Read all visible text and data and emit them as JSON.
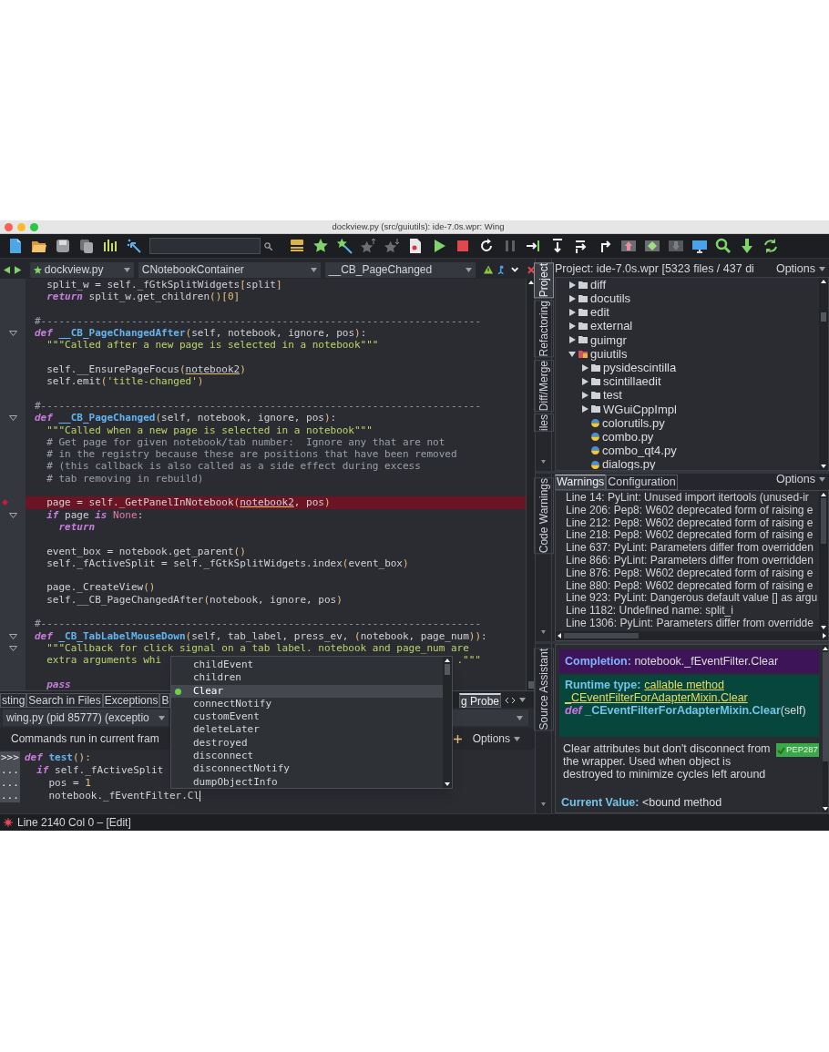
{
  "window": {
    "title": "dockview.py (src/guiutils): ide-7.0s.wpr: Wing"
  },
  "editor": {
    "file_menu": "dockview.py",
    "class_menu": "CNotebookContainer",
    "method_menu": "__CB_PageChanged",
    "lines": [
      {
        "fold": false,
        "error": false,
        "tokens": [
          {
            "kind": "p",
            "text": "  split_w = self._fGtkSplitWidgets"
          },
          {
            "kind": "pa",
            "text": "["
          },
          {
            "kind": "p",
            "text": "split"
          },
          {
            "kind": "pa",
            "text": "]"
          }
        ]
      },
      {
        "fold": false,
        "error": false,
        "tokens": [
          {
            "kind": "kw",
            "text": "  return"
          },
          {
            "kind": "p",
            "text": " split_w.get_children"
          },
          {
            "kind": "pa",
            "text": "()[0]"
          }
        ]
      },
      {
        "fold": false,
        "error": false
      },
      {
        "fold": false,
        "error": false,
        "tokens": [
          {
            "kind": "com",
            "text": "#-------------------------------------------------------------------------"
          }
        ]
      },
      {
        "fold": true,
        "error": false,
        "tokens": [
          {
            "kind": "kw",
            "text": "def"
          },
          {
            "kind": "fn",
            "text": " __CB_PageChangedAfter"
          },
          {
            "kind": "pa",
            "text": "("
          },
          {
            "kind": "p",
            "text": "self, notebook, ignore, pos"
          },
          {
            "kind": "pa",
            "text": ")"
          },
          {
            "kind": "p",
            "text": ":"
          }
        ]
      },
      {
        "fold": false,
        "error": false,
        "tokens": [
          {
            "kind": "str",
            "text": "  \"\"\"Called after a new page is selected in a notebook\"\"\""
          }
        ]
      },
      {
        "fold": false,
        "error": false
      },
      {
        "fold": false,
        "error": false,
        "tokens": [
          {
            "kind": "p",
            "text": "  self.__EnsurePageFocus"
          },
          {
            "kind": "pa",
            "text": "("
          },
          {
            "kind": "warn",
            "text": "notebook2"
          },
          {
            "kind": "pa",
            "text": ")"
          }
        ]
      },
      {
        "fold": false,
        "error": false,
        "tokens": [
          {
            "kind": "p",
            "text": "  self.emit"
          },
          {
            "kind": "pa",
            "text": "("
          },
          {
            "kind": "str",
            "text": "'title-changed'"
          },
          {
            "kind": "pa",
            "text": ")"
          }
        ]
      },
      {
        "fold": false,
        "error": false
      },
      {
        "fold": false,
        "error": false,
        "tokens": [
          {
            "kind": "com",
            "text": "#-------------------------------------------------------------------------"
          }
        ]
      },
      {
        "fold": true,
        "error": false,
        "tokens": [
          {
            "kind": "kw",
            "text": "def"
          },
          {
            "kind": "fn",
            "text": " __CB_PageChanged"
          },
          {
            "kind": "pa",
            "text": "("
          },
          {
            "kind": "p",
            "text": "self, notebook, ignore, pos"
          },
          {
            "kind": "pa",
            "text": ")"
          },
          {
            "kind": "p",
            "text": ":"
          }
        ]
      },
      {
        "fold": false,
        "error": false,
        "tokens": [
          {
            "kind": "str",
            "text": "  \"\"\"Called when a new page is selected in a notebook\"\"\""
          }
        ]
      },
      {
        "fold": false,
        "error": false,
        "tokens": [
          {
            "kind": "com",
            "text": "  # Get page for given notebook/tab number:  Ignore any that are not"
          }
        ]
      },
      {
        "fold": false,
        "error": false,
        "tokens": [
          {
            "kind": "com",
            "text": "  # in the registry because these are positions that have been removed"
          }
        ]
      },
      {
        "fold": false,
        "error": false,
        "tokens": [
          {
            "kind": "com",
            "text": "  # (this callback is also called as a side effect during excess"
          }
        ]
      },
      {
        "fold": false,
        "error": false,
        "tokens": [
          {
            "kind": "com",
            "text": "  # tab removing in rebuild)"
          }
        ]
      },
      {
        "fold": false,
        "error": false
      },
      {
        "fold": false,
        "error": true,
        "tokens": [
          {
            "kind": "p",
            "text": "  page = self._GetPanelInNotebook"
          },
          {
            "kind": "pa",
            "text": "("
          },
          {
            "kind": "warn",
            "text": "notebook2"
          },
          {
            "kind": "p",
            "text": ", pos"
          },
          {
            "kind": "pa",
            "text": ")"
          }
        ]
      },
      {
        "fold": true,
        "error": false,
        "tokens": [
          {
            "kind": "kw",
            "text": "  if"
          },
          {
            "kind": "p",
            "text": " page "
          },
          {
            "kind": "kw",
            "text": "is"
          },
          {
            "kind": "const",
            "text": " None"
          },
          {
            "kind": "p",
            "text": ":"
          }
        ]
      },
      {
        "fold": false,
        "error": false,
        "tokens": [
          {
            "kind": "kw",
            "text": "    return"
          }
        ]
      },
      {
        "fold": false,
        "error": false
      },
      {
        "fold": false,
        "error": false,
        "tokens": [
          {
            "kind": "p",
            "text": "  event_box = notebook.get_parent"
          },
          {
            "kind": "pa",
            "text": "()"
          }
        ]
      },
      {
        "fold": false,
        "error": false,
        "tokens": [
          {
            "kind": "p",
            "text": "  self._fActiveSplit = self._fGtkSplitWidgets.index"
          },
          {
            "kind": "pa",
            "text": "("
          },
          {
            "kind": "p",
            "text": "event_box"
          },
          {
            "kind": "pa",
            "text": ")"
          }
        ]
      },
      {
        "fold": false,
        "error": false
      },
      {
        "fold": false,
        "error": false,
        "tokens": [
          {
            "kind": "p",
            "text": "  page._CreateView"
          },
          {
            "kind": "pa",
            "text": "()"
          }
        ]
      },
      {
        "fold": false,
        "error": false,
        "tokens": [
          {
            "kind": "p",
            "text": "  self.__CB_PageChangedAfter"
          },
          {
            "kind": "pa",
            "text": "("
          },
          {
            "kind": "p",
            "text": "notebook, ignore, pos"
          },
          {
            "kind": "pa",
            "text": ")"
          }
        ]
      },
      {
        "fold": false,
        "error": false
      },
      {
        "fold": false,
        "error": false,
        "tokens": [
          {
            "kind": "com",
            "text": "#-------------------------------------------------------------------------"
          }
        ]
      },
      {
        "fold": true,
        "error": false,
        "tokens": [
          {
            "kind": "kw",
            "text": "def"
          },
          {
            "kind": "fn",
            "text": " _CB_TabLabelMouseDown"
          },
          {
            "kind": "pa",
            "text": "("
          },
          {
            "kind": "p",
            "text": "self, tab_label, press_ev, "
          },
          {
            "kind": "pa",
            "text": "("
          },
          {
            "kind": "p",
            "text": "notebook, page_num"
          },
          {
            "kind": "pa",
            "text": "))"
          },
          {
            "kind": "p",
            "text": ":"
          }
        ]
      },
      {
        "fold": true,
        "error": false,
        "tokens": [
          {
            "kind": "str",
            "text": "  \"\"\"Callback for click signal on a tab label. notebook and page_num are"
          }
        ]
      },
      {
        "fold": false,
        "error": false,
        "segments": [
          {
            "tokens": [
              {
                "kind": "str",
                "text": "  extra arguments whi"
              }
            ]
          },
          {
            "tokens": [
              {
                "kind": "str",
                "text": ".\"\"\""
              }
            ]
          }
        ]
      },
      {
        "fold": false,
        "error": false
      },
      {
        "fold": false,
        "error": false,
        "tokens": [
          {
            "kind": "kw",
            "text": "  pass"
          }
        ]
      }
    ]
  },
  "completion_popup": {
    "items": [
      {
        "text": "childEvent",
        "selected": false
      },
      {
        "text": "children",
        "selected": false
      },
      {
        "text": "Clear",
        "selected": true
      },
      {
        "text": "connectNotify",
        "selected": false
      },
      {
        "text": "customEvent",
        "selected": false
      },
      {
        "text": "deleteLater",
        "selected": false
      },
      {
        "text": "destroyed",
        "selected": false
      },
      {
        "text": "disconnect",
        "selected": false
      },
      {
        "text": "disconnectNotify",
        "selected": false
      },
      {
        "text": "dumpObjectInfo",
        "selected": false
      }
    ]
  },
  "bottom_panel": {
    "tabs": [
      {
        "label": "sting",
        "selected": false
      },
      {
        "label": "Search in Files",
        "selected": false
      },
      {
        "label": "Exceptions",
        "selected": false
      },
      {
        "label": "B",
        "selected": false
      },
      {
        "label": "g Probe",
        "selected": true
      }
    ],
    "process_menu": "wing.py (pid 85777) (exceptio",
    "commands_label": "Commands run in current fram",
    "options": "Options",
    "shell": [
      {
        "prompt": ">>>",
        "tokens": [
          {
            "kind": "kw",
            "text": "def"
          },
          {
            "kind": "fn",
            "text": " test"
          },
          {
            "kind": "pa",
            "text": "():"
          }
        ]
      },
      {
        "prompt": "...",
        "tokens": [
          {
            "kind": "kw",
            "text": "  if"
          },
          {
            "kind": "p",
            "text": " self._fActiveSplit"
          }
        ]
      },
      {
        "prompt": "...",
        "tokens": [
          {
            "kind": "p",
            "text": "    pos = "
          },
          {
            "kind": "num",
            "text": "1"
          }
        ]
      },
      {
        "prompt": "...",
        "tokens": [
          {
            "kind": "p",
            "text": "    notebook._fEventFilter.Cl"
          }
        ]
      }
    ]
  },
  "status_bar": {
    "text": "Line 2140 Col 0 – [Edit]"
  },
  "project": {
    "vertical_tabs": [
      {
        "label": "Project",
        "selected": true
      },
      {
        "label": "Refactoring",
        "selected": false
      },
      {
        "label": "Diff/Merge",
        "selected": false
      },
      {
        "label": "iles",
        "selected": false
      }
    ],
    "title": "Project: ide-7.0s.wpr [5323 files / 437 di",
    "options": "Options",
    "tree": [
      {
        "label": "diff",
        "kind": "folder",
        "expanded": false
      },
      {
        "label": "docutils",
        "kind": "folder",
        "expanded": false
      },
      {
        "label": "edit",
        "kind": "folder",
        "expanded": false
      },
      {
        "label": "external",
        "kind": "folder",
        "expanded": false
      },
      {
        "label": "guimgr",
        "kind": "folder",
        "expanded": false
      },
      {
        "label": "guiutils",
        "kind": "package",
        "expanded": true,
        "children": [
          {
            "label": "pysidescintilla",
            "kind": "folder",
            "expanded": false
          },
          {
            "label": "scintillaedit",
            "kind": "folder",
            "expanded": false
          },
          {
            "label": "test",
            "kind": "folder",
            "expanded": false
          },
          {
            "label": "WGuiCppImpl",
            "kind": "folder",
            "expanded": false
          },
          {
            "label": "colorutils.py",
            "kind": "file"
          },
          {
            "label": "combo.py",
            "kind": "file"
          },
          {
            "label": "combo_qt4.py",
            "kind": "file"
          },
          {
            "label": "dialogs.py",
            "kind": "file"
          }
        ]
      }
    ]
  },
  "warnings": {
    "vertical_tab": "Code Warnings",
    "tabs": [
      {
        "label": "Warnings",
        "selected": true
      },
      {
        "label": "Configuration",
        "selected": false
      }
    ],
    "options": "Options",
    "items": [
      "Line 14: PyLint: Unused import itertools (unused-ir",
      "Line 206: Pep8: W602 deprecated form of raising e",
      "Line 212: Pep8: W602 deprecated form of raising e",
      "Line 218: Pep8: W602 deprecated form of raising e",
      "Line 637: PyLint: Parameters differ from overridden",
      "Line 866: PyLint: Parameters differ from overridden",
      "Line 876: Pep8: W602 deprecated form of raising e",
      "Line 880: Pep8: W602 deprecated form of raising e",
      "Line 923: PyLint: Dangerous default value [] as argu",
      "Line 1182: Undefined name: split_i",
      "Line 1306: PyLint: Parameters differ from overridde"
    ]
  },
  "source_assistant": {
    "vertical_tab": "Source Assistant",
    "completion_label": "Completion:",
    "completion_value": "notebook._fEventFilter.Clear",
    "runtime_label": "Runtime type:",
    "runtime_links": [
      "callable method",
      "_CEventFilterForAdapterMixin.Clear"
    ],
    "signature": {
      "keyword": "def",
      "name": "_CEventFilterForAdapterMixin.Clear",
      "args": "(self)"
    },
    "description": "Clear attributes but don't disconnect from the wrapper. Used when object is destroyed to minimize cycles left around",
    "badge": "PEP287",
    "current_value_label": "Current Value:",
    "current_value": "<bound method"
  }
}
